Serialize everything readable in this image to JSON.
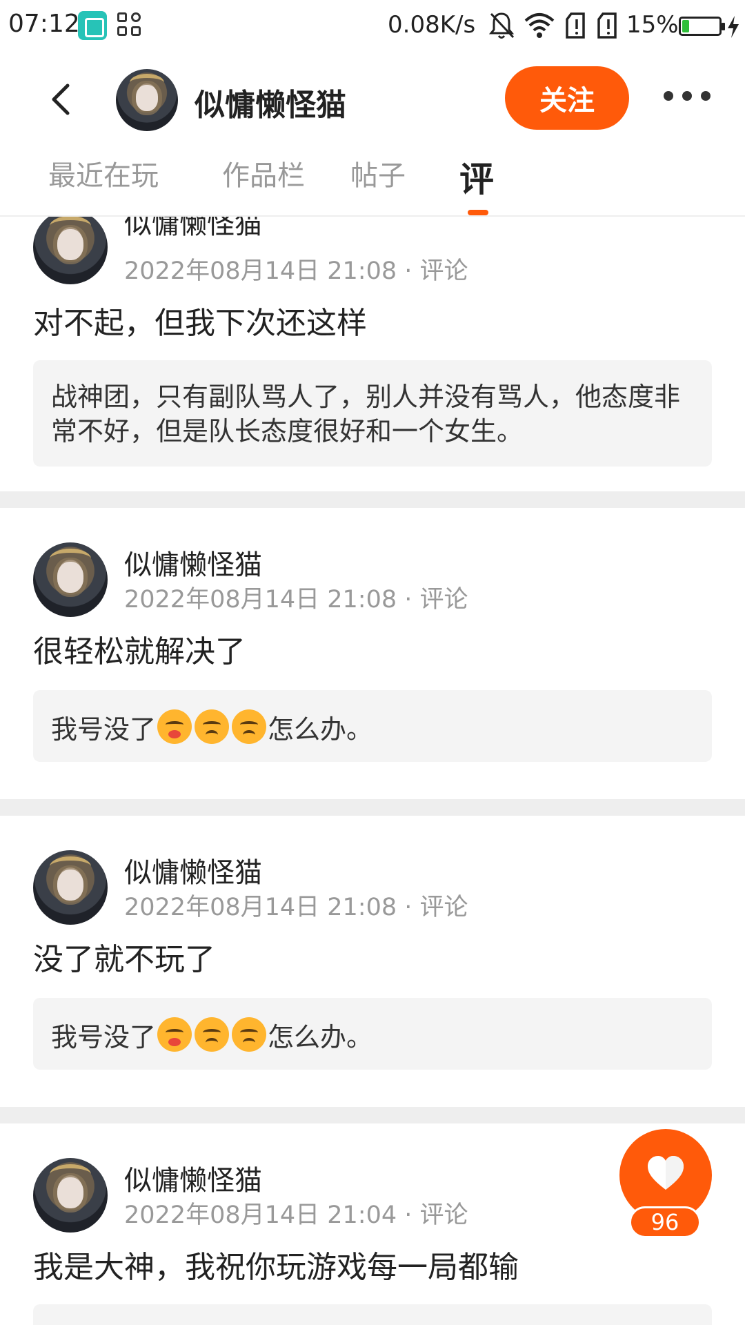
{
  "status_bar": {
    "time": "07:12",
    "net_speed": "0.08K/s",
    "battery_pct": "15%",
    "icons": [
      "qr-scan-app-icon",
      "apps-icon",
      "mute-bell-icon",
      "wifi-icon",
      "sim1-icon",
      "sim2-icon",
      "battery-icon",
      "charging-bolt-icon"
    ]
  },
  "header": {
    "user_name": "似慵懒怪猫",
    "follow_label": "关注"
  },
  "tabs": [
    {
      "label": "最近在玩"
    },
    {
      "label": "作品栏"
    },
    {
      "label": "帖子"
    },
    {
      "label": "评",
      "active": true
    }
  ],
  "comments": [
    {
      "author": "似慵懒怪猫",
      "time": "2022年08月14日 21:08",
      "type": "评论",
      "text": "对不起，但我下次还这样",
      "quote": "战神团，只有副队骂人了，别人并没有骂人，他态度非常不好，但是队长态度很好和一个女生。"
    },
    {
      "author": "似慵懒怪猫",
      "time": "2022年08月14日 21:08",
      "type": "评论",
      "text": "很轻松就解决了",
      "quote_prefix": "我号没了",
      "quote_suffix": "怎么办。"
    },
    {
      "author": "似慵懒怪猫",
      "time": "2022年08月14日 21:08",
      "type": "评论",
      "text": "没了就不玩了",
      "quote_prefix": "我号没了",
      "quote_suffix": "怎么办。"
    },
    {
      "author": "似慵懒怪猫",
      "time": "2022年08月14日 21:04",
      "type": "评论",
      "text": "我是大神，我祝你玩游戏每一局都输"
    }
  ],
  "like": {
    "count": "96"
  },
  "colors": {
    "accent": "#ff5a0a",
    "quote_bg": "#f4f4f4",
    "separator": "#eeeeee",
    "meta_text": "#999999"
  }
}
